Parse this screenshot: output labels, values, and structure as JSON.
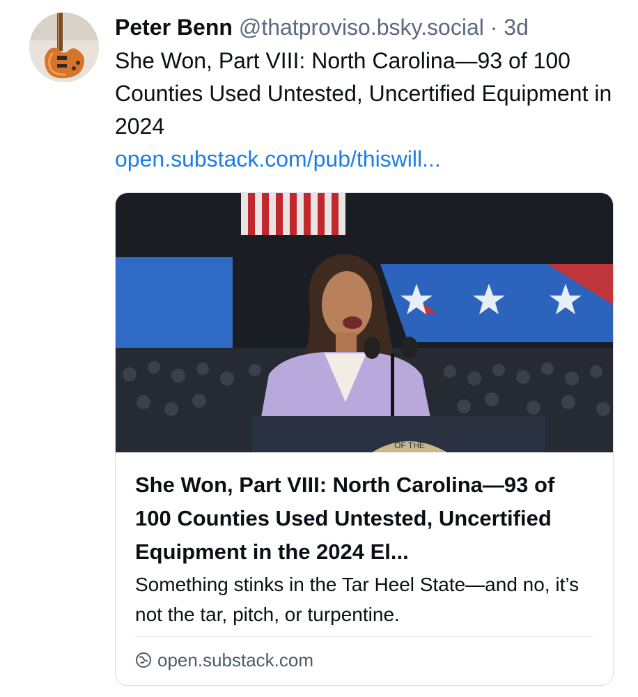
{
  "post": {
    "author_name": "Peter Benn",
    "handle": "@thatproviso.bsky.social",
    "separator": "·",
    "time": "3d",
    "text": "She Won, Part VIII: North Carolina—93 of 100 Counties Used Untested, Uncertified Equipment in 2024",
    "link_text": "open.substack.com/pub/thiswill..."
  },
  "card": {
    "image_icon": "photo-speaker-at-podium-icon",
    "seal_text": "OF THE",
    "title": "She Won, Part VIII: North Carolina—93 of 100 Counties Used Untested, Uncertified Equipment in the 2024 El...",
    "description": "Something stinks in the Tar Heel State—and no, it’s not the tar, pitch, or turpentine.",
    "domain": "open.substack.com",
    "domain_icon": "globe-icon"
  },
  "colors": {
    "link": "#1a7ee8",
    "muted": "#5a6a7c",
    "border": "#d6dde4"
  }
}
